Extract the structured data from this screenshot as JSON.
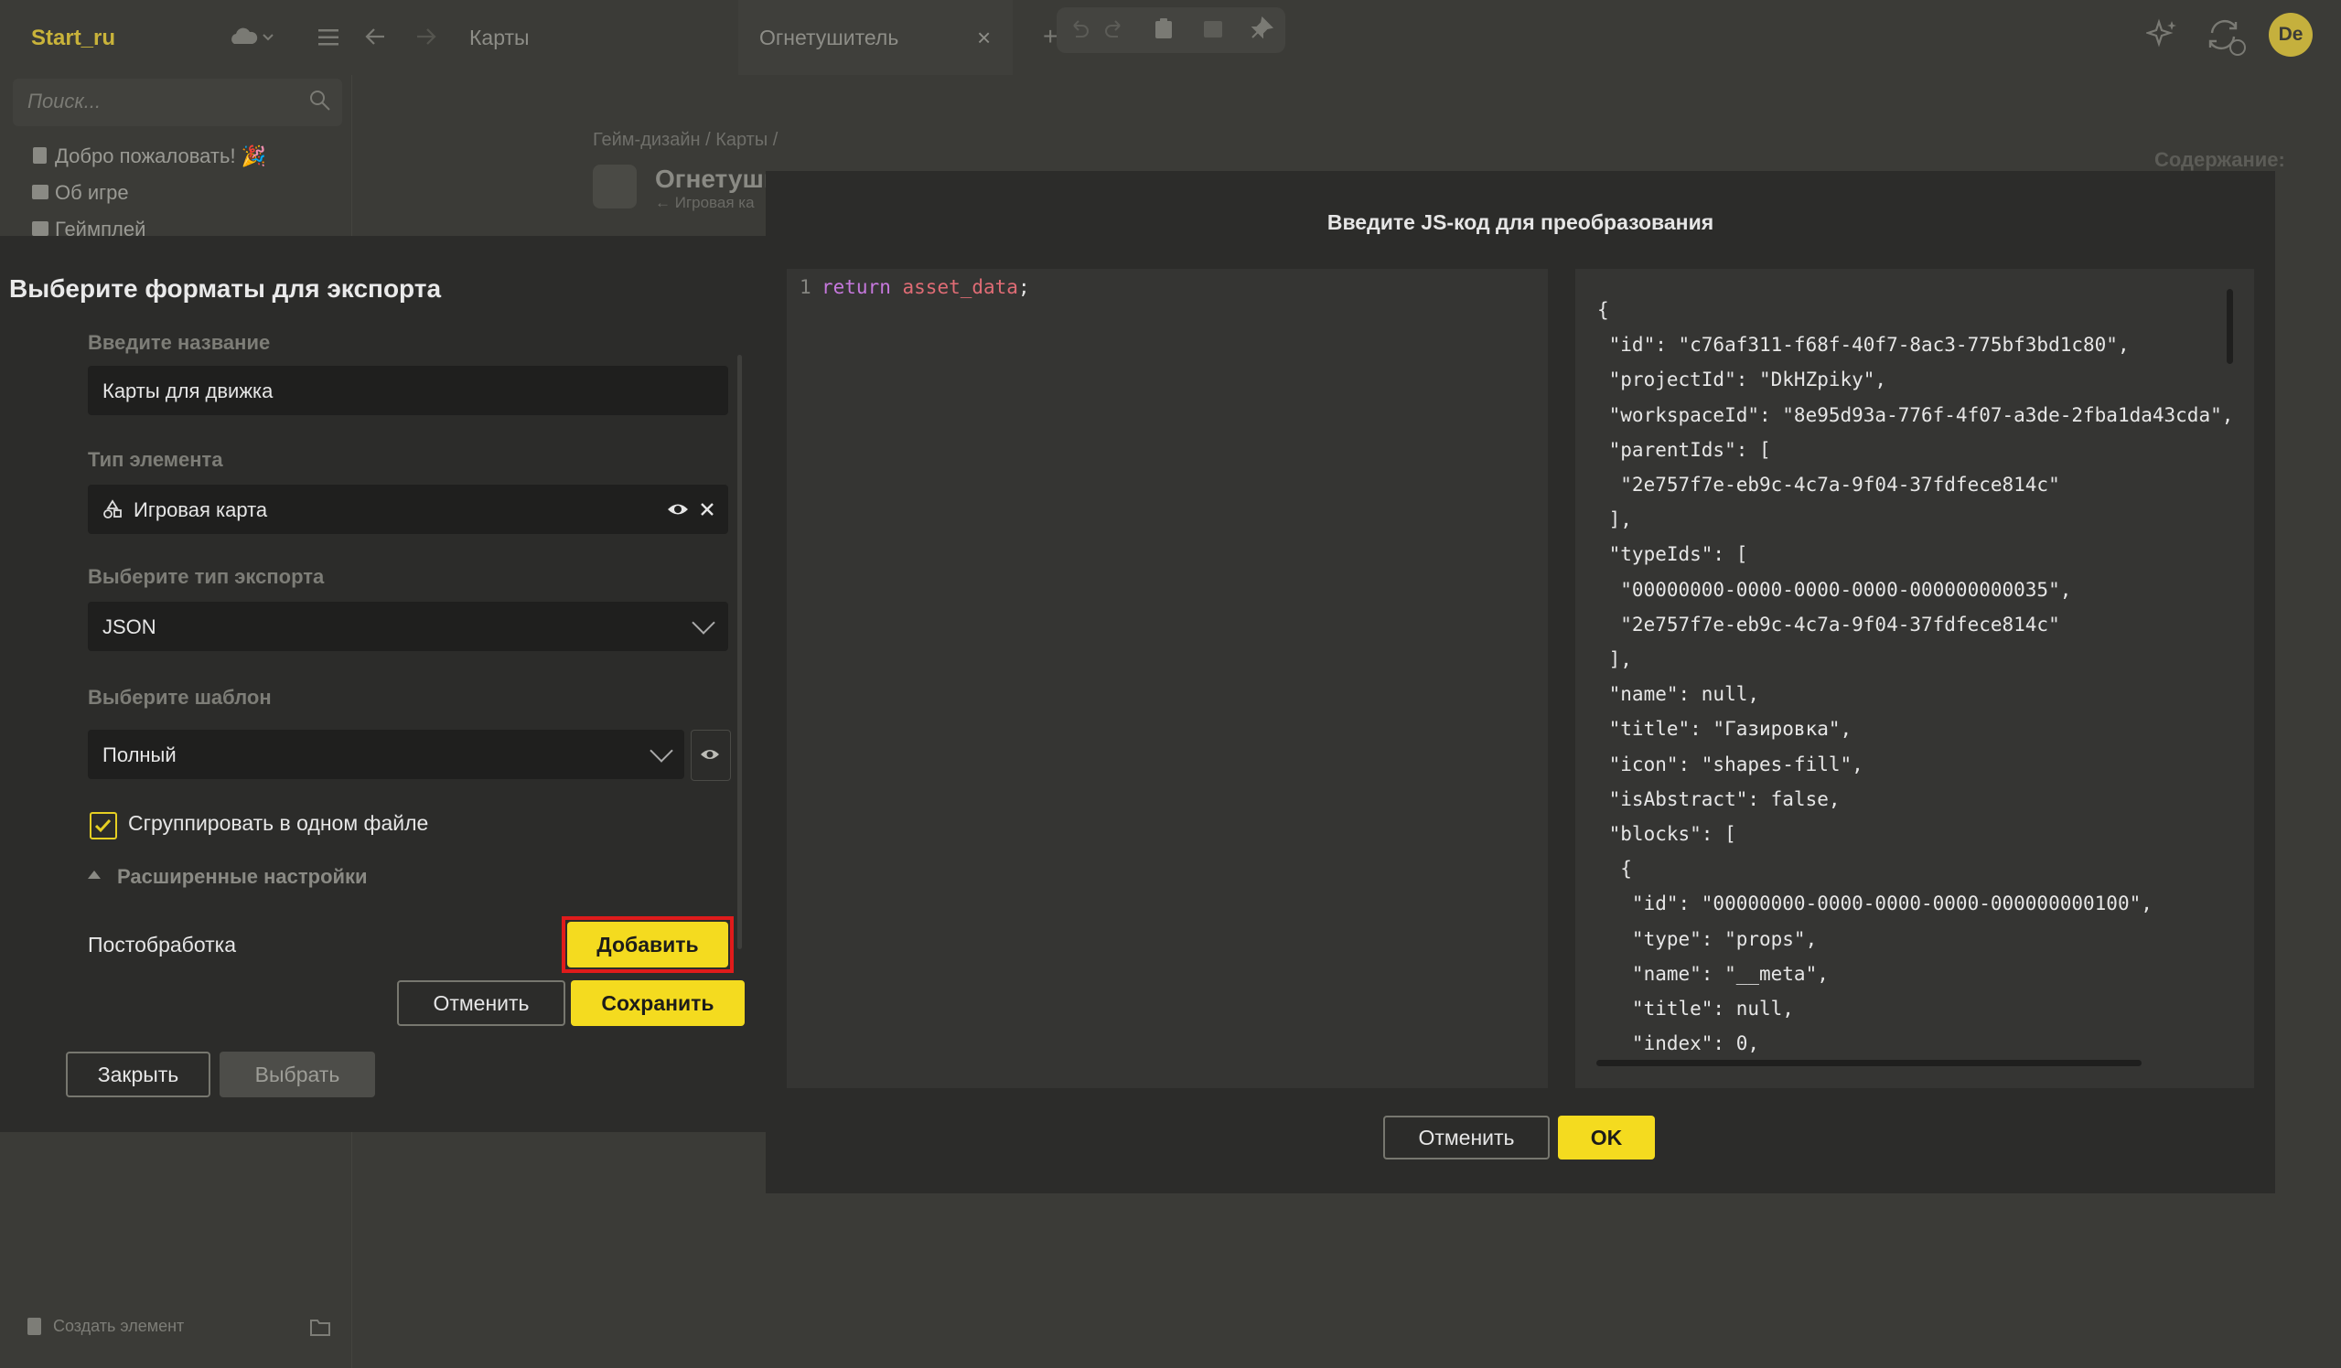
{
  "app": {
    "brand": "Start_ru",
    "breadcrumb_top": "Карты",
    "tab_label": "Огнетушитель",
    "avatar_initials": "De",
    "search_placeholder": "Поиск...",
    "nav": [
      {
        "label": "Добро пожаловать! 🎉",
        "icon": "doc-icon"
      },
      {
        "label": "Об игре",
        "icon": "image-icon"
      },
      {
        "label": "Геймплей",
        "icon": "image-icon"
      }
    ],
    "create_element": "Создать элемент",
    "page_breadcrumb": "Гейм-дизайн / Карты /",
    "page_title": "Огнетуши",
    "page_subtitle": "← Игровая ка",
    "toc_title": "Содержание:"
  },
  "export_dialog": {
    "title": "Выберите форматы для экспорта",
    "name_label": "Введите название",
    "name_value": "Карты для движка",
    "type_label": "Тип элемента",
    "type_value": "Игровая карта",
    "export_type_label": "Выберите тип экспорта",
    "export_type_value": "JSON",
    "template_label": "Выберите шаблон",
    "template_value": "Полный",
    "group_checkbox_label": "Сгруппировать в одном файле",
    "group_checked": true,
    "advanced_label": "Расширенные настройки",
    "postprocessing_label": "Постобработка",
    "add_button": "Добавить",
    "cancel_button": "Отменить",
    "save_button": "Сохранить",
    "close_button": "Закрыть",
    "select_button": "Выбрать"
  },
  "js_dialog": {
    "title": "Введите JS-код для преобразования",
    "line_number": "1",
    "code_keyword": "return",
    "code_identifier": "asset_data",
    "code_punct": ";",
    "preview_lines": [
      "{",
      " \"id\": \"c76af311-f68f-40f7-8ac3-775bf3bd1c80\",",
      " \"projectId\": \"DkHZpiky\",",
      " \"workspaceId\": \"8e95d93a-776f-4f07-a3de-2fba1da43cda\",",
      " \"parentIds\": [",
      "  \"2e757f7e-eb9c-4c7a-9f04-37fdfece814c\"",
      " ],",
      " \"typeIds\": [",
      "  \"00000000-0000-0000-0000-000000000035\",",
      "  \"2e757f7e-eb9c-4c7a-9f04-37fdfece814c\"",
      " ],",
      " \"name\": null,",
      " \"title\": \"Газировка\",",
      " \"icon\": \"shapes-fill\",",
      " \"isAbstract\": false,",
      " \"blocks\": [",
      "  {",
      "   \"id\": \"00000000-0000-0000-0000-000000000100\",",
      "   \"type\": \"props\",",
      "   \"name\": \"__meta\",",
      "   \"title\": null,",
      "   \"index\": 0,"
    ],
    "cancel_button": "Отменить",
    "ok_button": "OK"
  },
  "colors": {
    "accent": "#f4db1f",
    "highlight_outline": "#e01b1b",
    "code_keyword": "#c678dd",
    "code_identifier": "#e06c75"
  }
}
